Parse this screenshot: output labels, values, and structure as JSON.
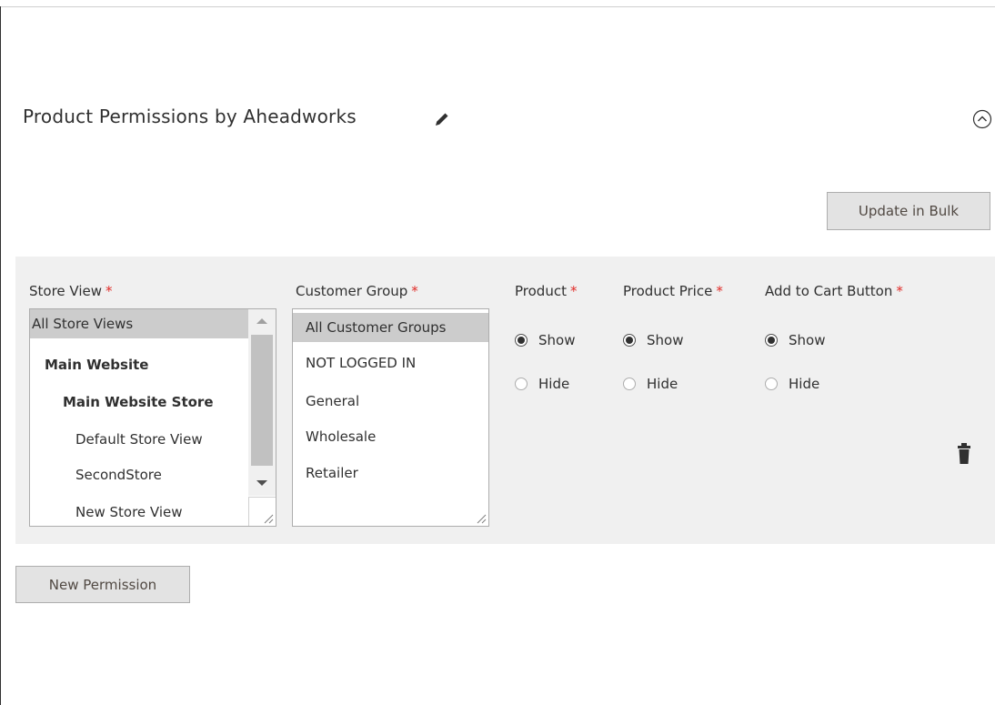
{
  "section": {
    "title": "Product Permissions by Aheadworks",
    "edit_icon": "pencil-icon",
    "collapse_icon": "chevron-up-circle-icon"
  },
  "toolbar": {
    "update_bulk_label": "Update in Bulk"
  },
  "permission_row": {
    "columns": {
      "store_view": "Store View",
      "customer_group": "Customer Group",
      "product": "Product",
      "product_price": "Product Price",
      "add_to_cart": "Add to Cart Button"
    },
    "required_mark": "*",
    "store_views": [
      {
        "label": "All Store Views",
        "selected": true,
        "level": 0,
        "bold": false
      },
      {
        "label": "Main Website",
        "selected": false,
        "level": 1,
        "bold": true
      },
      {
        "label": "Main Website Store",
        "selected": false,
        "level": 2,
        "bold": true
      },
      {
        "label": "Default Store View",
        "selected": false,
        "level": 3,
        "bold": false
      },
      {
        "label": "SecondStore",
        "selected": false,
        "level": 3,
        "bold": false
      },
      {
        "label": "New Store View",
        "selected": false,
        "level": 3,
        "bold": false
      }
    ],
    "customer_groups": [
      {
        "label": "All Customer Groups",
        "selected": true
      },
      {
        "label": "NOT LOGGED IN",
        "selected": false
      },
      {
        "label": "General",
        "selected": false
      },
      {
        "label": "Wholesale",
        "selected": false
      },
      {
        "label": "Retailer",
        "selected": false
      }
    ],
    "product": {
      "show_label": "Show",
      "hide_label": "Hide",
      "value": "Show"
    },
    "product_price": {
      "show_label": "Show",
      "hide_label": "Hide",
      "value": "Show"
    },
    "add_to_cart": {
      "show_label": "Show",
      "hide_label": "Hide",
      "value": "Show"
    },
    "delete_icon": "trash-icon"
  },
  "footer": {
    "new_permission_label": "New Permission"
  },
  "colors": {
    "panel_bg": "#f0f0f0",
    "required": "#e02b27",
    "button_bg": "#e3e3e3",
    "selected_option": "#cccccc"
  }
}
